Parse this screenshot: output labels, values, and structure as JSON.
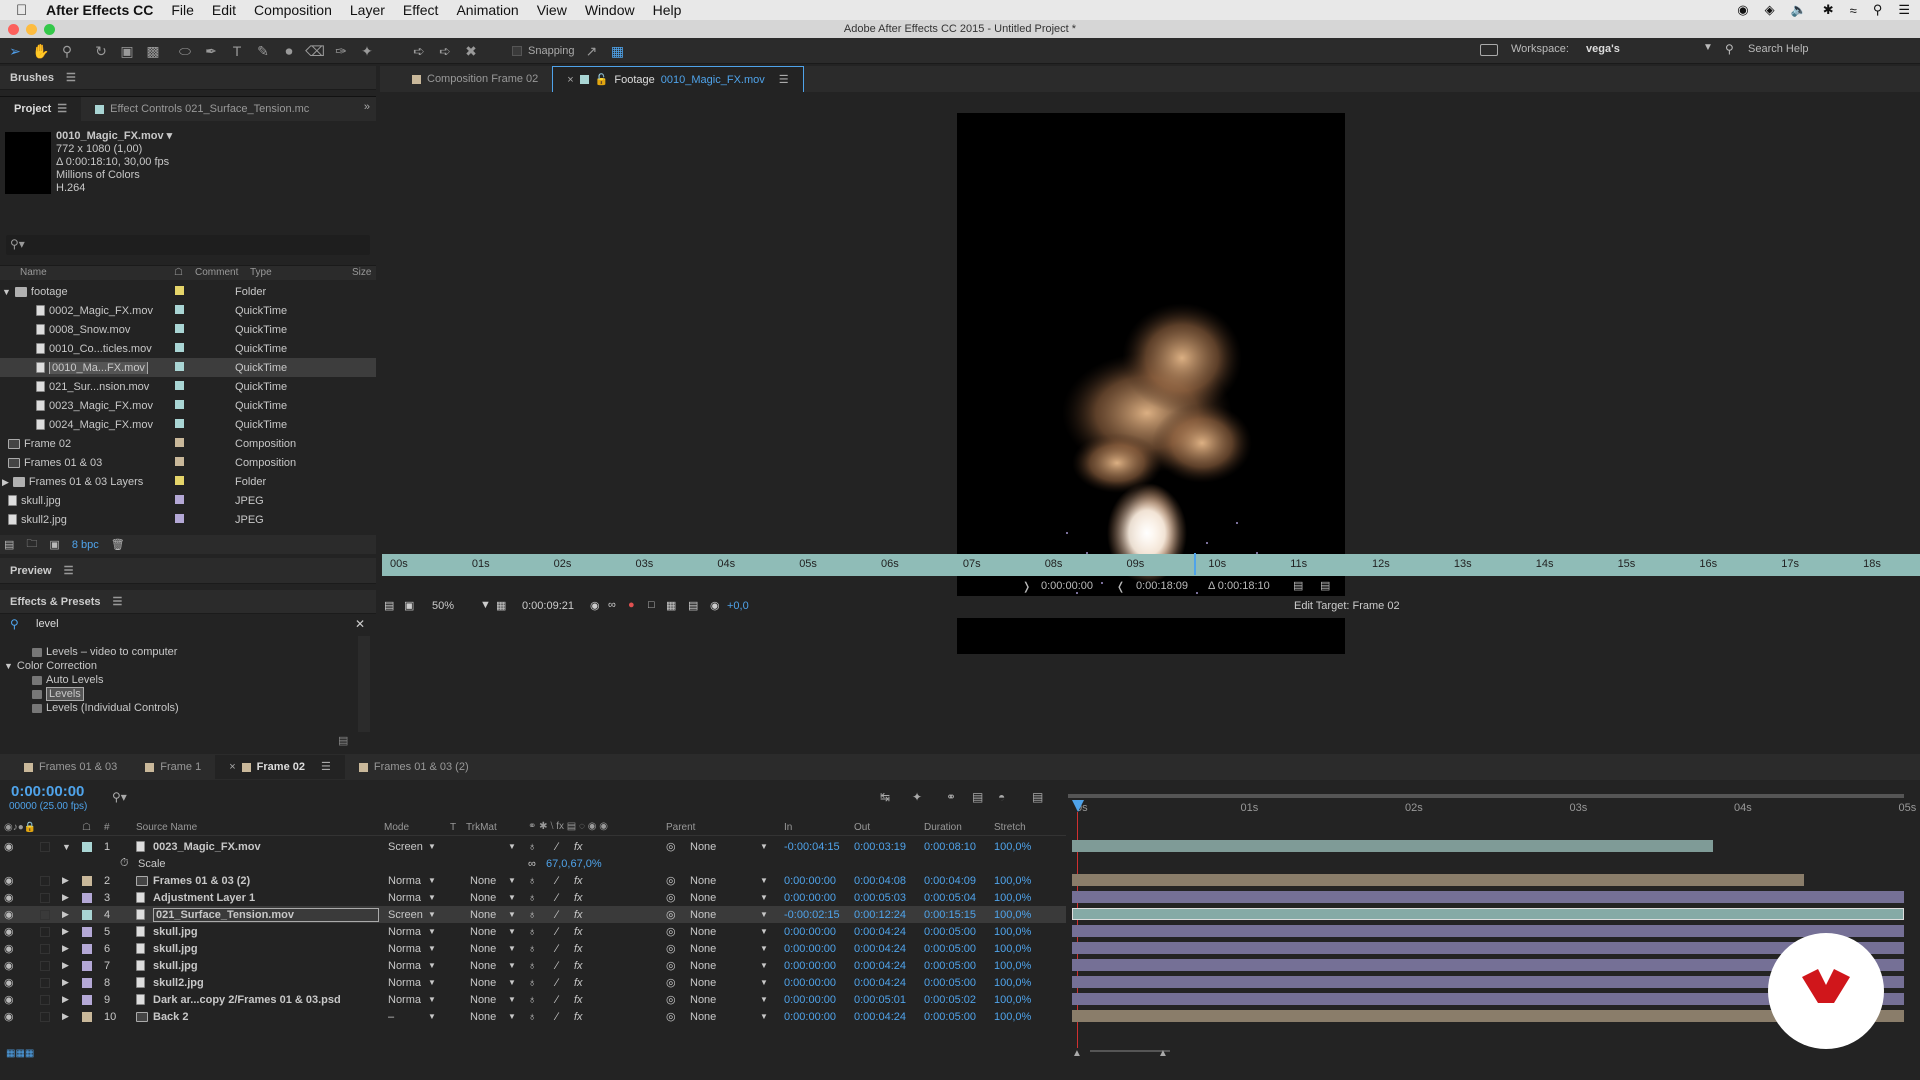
{
  "menubar": {
    "app": "After Effects CC",
    "items": [
      "File",
      "Edit",
      "Composition",
      "Layer",
      "Effect",
      "Animation",
      "View",
      "Window",
      "Help"
    ]
  },
  "window_title": "Adobe After Effects CC 2015 - Untitled Project *",
  "toolbar": {
    "snapping": "Snapping",
    "workspace_label": "Workspace:",
    "workspace_value": "vega's",
    "search_help": "Search Help"
  },
  "brushes_panel": {
    "title": "Brushes"
  },
  "project_panel": {
    "tab_project": "Project",
    "tab_effect_controls": "Effect Controls 021_Surface_Tension.mc",
    "selected_info": {
      "name": "0010_Magic_FX.mov ▾",
      "dims": "772 x 1080 (1,00)",
      "duration": "Δ 0:00:18:10, 30,00 fps",
      "colors": "Millions of Colors",
      "codec": "H.264"
    },
    "columns": {
      "name": "Name",
      "comment": "Comment",
      "type": "Type",
      "size": "Size"
    },
    "items": [
      {
        "name": "footage",
        "type": "Folder",
        "color": "#e5d46a",
        "kind": "folder",
        "indent": 0,
        "open": true
      },
      {
        "name": "0002_Magic_FX.mov",
        "type": "QuickTime",
        "color": "#a9d5d4",
        "kind": "file",
        "indent": 1
      },
      {
        "name": "0008_Snow.mov",
        "type": "QuickTime",
        "color": "#a9d5d4",
        "kind": "file",
        "indent": 1
      },
      {
        "name": "0010_Co...ticles.mov",
        "type": "QuickTime",
        "color": "#a9d5d4",
        "kind": "file",
        "indent": 1
      },
      {
        "name": "0010_Ma...FX.mov",
        "type": "QuickTime",
        "color": "#a9d5d4",
        "kind": "file",
        "indent": 1,
        "selected": true
      },
      {
        "name": "021_Sur...nsion.mov",
        "type": "QuickTime",
        "color": "#a9d5d4",
        "kind": "file",
        "indent": 1
      },
      {
        "name": "0023_Magic_FX.mov",
        "type": "QuickTime",
        "color": "#a9d5d4",
        "kind": "file",
        "indent": 1
      },
      {
        "name": "0024_Magic_FX.mov",
        "type": "QuickTime",
        "color": "#a9d5d4",
        "kind": "file",
        "indent": 1
      },
      {
        "name": "Frame 02",
        "type": "Composition",
        "color": "#c9b89a",
        "kind": "comp",
        "indent": 0
      },
      {
        "name": "Frames 01 & 03",
        "type": "Composition",
        "color": "#c9b89a",
        "kind": "comp",
        "indent": 0
      },
      {
        "name": "Frames 01 & 03 Layers",
        "type": "Folder",
        "color": "#e5d46a",
        "kind": "folder",
        "indent": 0
      },
      {
        "name": "skull.jpg",
        "type": "JPEG",
        "color": "#b4a8d6",
        "kind": "file",
        "indent": 0
      },
      {
        "name": "skull2.jpg",
        "type": "JPEG",
        "color": "#b4a8d6",
        "kind": "file",
        "indent": 0
      }
    ],
    "bpc": "8 bpc"
  },
  "preview_panel": {
    "title": "Preview"
  },
  "effects_panel": {
    "title": "Effects & Presets",
    "search_value": "level",
    "items": [
      {
        "text": "Levels – video to computer",
        "indent": 2,
        "kind": "preset"
      },
      {
        "text": "Color Correction",
        "indent": 0,
        "kind": "group"
      },
      {
        "text": "Auto Levels",
        "indent": 2,
        "kind": "effect"
      },
      {
        "text": "Levels",
        "indent": 2,
        "kind": "effect",
        "selected": true
      },
      {
        "text": "Levels (Individual Controls)",
        "indent": 2,
        "kind": "effect"
      }
    ]
  },
  "viewer": {
    "tab_comp": "Composition Frame 02",
    "tab_footage_prefix": "Footage",
    "tab_footage_name": "0010_Magic_FX.mov",
    "ruler_labels": [
      "00s",
      "01s",
      "02s",
      "03s",
      "04s",
      "05s",
      "06s",
      "07s",
      "08s",
      "09s",
      "10s",
      "11s",
      "12s",
      "13s",
      "14s",
      "15s",
      "16s",
      "17s",
      "18s"
    ],
    "in_time": "0:00:00:00",
    "out_time": "0:00:18:09",
    "duration": "Δ 0:00:18:10",
    "zoom": "50%",
    "current_time": "0:00:09:21",
    "exposure": "+0,0",
    "edit_target": "Edit Target: Frame 02"
  },
  "timeline": {
    "tabs": [
      "Frames 01 & 03",
      "Frame 1",
      "Frame 02",
      "Frames 01 & 03 (2)"
    ],
    "active_tab": "Frame 02",
    "timecode": "0:00:00:00",
    "frames_fps": "00000 (25.00 fps)",
    "columns": {
      "num": "#",
      "source": "Source Name",
      "mode": "Mode",
      "t": "T",
      "trkmat": "TrkMat",
      "parent": "Parent",
      "in": "In",
      "out": "Out",
      "duration": "Duration",
      "stretch": "Stretch"
    },
    "ruler_labels": [
      "0s",
      "01s",
      "02s",
      "03s",
      "04s",
      "05s"
    ],
    "scale_label": "Scale",
    "scale_value": "67,0,67,0%",
    "layers": [
      {
        "num": "1",
        "name": "0023_Magic_FX.mov",
        "mode": "Screen",
        "trkmat": "",
        "parent": "None",
        "in": "-0:00:04:15",
        "out": "0:00:03:19",
        "dur": "0:00:08:10",
        "stretch": "100,0%",
        "color": "#a9d5d4",
        "bar": "#7f9b97",
        "barEnd": 0.77,
        "kind": "file",
        "open": true
      },
      {
        "num": "2",
        "name": "Frames 01 & 03 (2)",
        "mode": "Norma",
        "trkmat": "None",
        "parent": "None",
        "in": "0:00:00:00",
        "out": "0:00:04:08",
        "dur": "0:00:04:09",
        "stretch": "100,0%",
        "color": "#c9b89a",
        "bar": "#8a7d6a",
        "barEnd": 0.88,
        "kind": "comp"
      },
      {
        "num": "3",
        "name": "Adjustment Layer 1",
        "mode": "Norma",
        "trkmat": "None",
        "parent": "None",
        "in": "0:00:00:00",
        "out": "0:00:05:03",
        "dur": "0:00:05:04",
        "stretch": "100,0%",
        "color": "#b4a8d6",
        "bar": "#757096",
        "barEnd": 1.0,
        "kind": "solid"
      },
      {
        "num": "4",
        "name": "021_Surface_Tension.mov",
        "mode": "Screen",
        "trkmat": "None",
        "parent": "None",
        "in": "-0:00:02:15",
        "out": "0:00:12:24",
        "dur": "0:00:15:15",
        "stretch": "100,0%",
        "color": "#a9d5d4",
        "bar": "#85aaa6",
        "barEnd": 1.0,
        "kind": "file",
        "selected": true
      },
      {
        "num": "5",
        "name": "skull.jpg",
        "mode": "Norma",
        "trkmat": "None",
        "parent": "None",
        "in": "0:00:00:00",
        "out": "0:00:04:24",
        "dur": "0:00:05:00",
        "stretch": "100,0%",
        "color": "#b4a8d6",
        "bar": "#757096",
        "barEnd": 1.0,
        "kind": "file"
      },
      {
        "num": "6",
        "name": "skull.jpg",
        "mode": "Norma",
        "trkmat": "None",
        "parent": "None",
        "in": "0:00:00:00",
        "out": "0:00:04:24",
        "dur": "0:00:05:00",
        "stretch": "100,0%",
        "color": "#b4a8d6",
        "bar": "#757096",
        "barEnd": 1.0,
        "kind": "file"
      },
      {
        "num": "7",
        "name": "skull.jpg",
        "mode": "Norma",
        "trkmat": "None",
        "parent": "None",
        "in": "0:00:00:00",
        "out": "0:00:04:24",
        "dur": "0:00:05:00",
        "stretch": "100,0%",
        "color": "#b4a8d6",
        "bar": "#757096",
        "barEnd": 1.0,
        "kind": "file"
      },
      {
        "num": "8",
        "name": "skull2.jpg",
        "mode": "Norma",
        "trkmat": "None",
        "parent": "None",
        "in": "0:00:00:00",
        "out": "0:00:04:24",
        "dur": "0:00:05:00",
        "stretch": "100,0%",
        "color": "#b4a8d6",
        "bar": "#757096",
        "barEnd": 1.0,
        "kind": "file"
      },
      {
        "num": "9",
        "name": "Dark ar...copy 2/Frames 01 & 03.psd",
        "mode": "Norma",
        "trkmat": "None",
        "parent": "None",
        "in": "0:00:00:00",
        "out": "0:00:05:01",
        "dur": "0:00:05:02",
        "stretch": "100,0%",
        "color": "#b4a8d6",
        "bar": "#757096",
        "barEnd": 1.0,
        "kind": "psd"
      },
      {
        "num": "10",
        "name": "Back 2",
        "mode": "–",
        "trkmat": "None",
        "parent": "None",
        "in": "0:00:00:00",
        "out": "0:00:04:24",
        "dur": "0:00:05:00",
        "stretch": "100,0%",
        "color": "#c9b89a",
        "bar": "#8a7d6a",
        "barEnd": 1.0,
        "kind": "comp"
      }
    ]
  },
  "colors": {
    "accent": "#4fa3ea",
    "badge": "#d0161b",
    "ruler_teal": "#8fbcb7"
  }
}
